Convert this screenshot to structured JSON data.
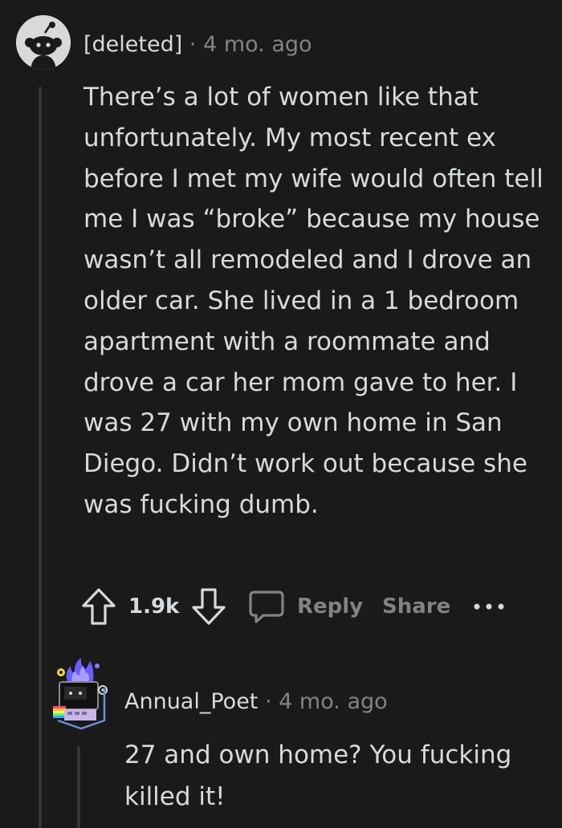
{
  "comment": {
    "username": "[deleted]",
    "separator": "·",
    "time": "4 mo. ago",
    "body": "There’s a lot of women like that unfortunately. My most recent ex before I met my wife would often tell me I was “broke” because my house wasn’t all remodeled and I drove an older car. She lived in a 1 bedroom apartment with a roommate and drove a car her mom gave to her. I was 27 with my own home in San Diego. Didn’t work out because she was fucking dumb.",
    "score": "1.9k",
    "reply_label": "Reply",
    "share_label": "Share"
  },
  "reply": {
    "username": "Annual_Poet",
    "separator": "·",
    "time": "4 mo. ago",
    "body": "27 and own home? You fucking killed it!"
  },
  "icons": {
    "upvote": "upvote-arrow-icon",
    "downvote": "downvote-arrow-icon",
    "reply": "speech-bubble-icon",
    "more": "ellipsis-icon"
  },
  "colors": {
    "background": "#1a1a1b",
    "text": "#d7dadc",
    "muted": "#818384",
    "thread_line": "#343536"
  }
}
